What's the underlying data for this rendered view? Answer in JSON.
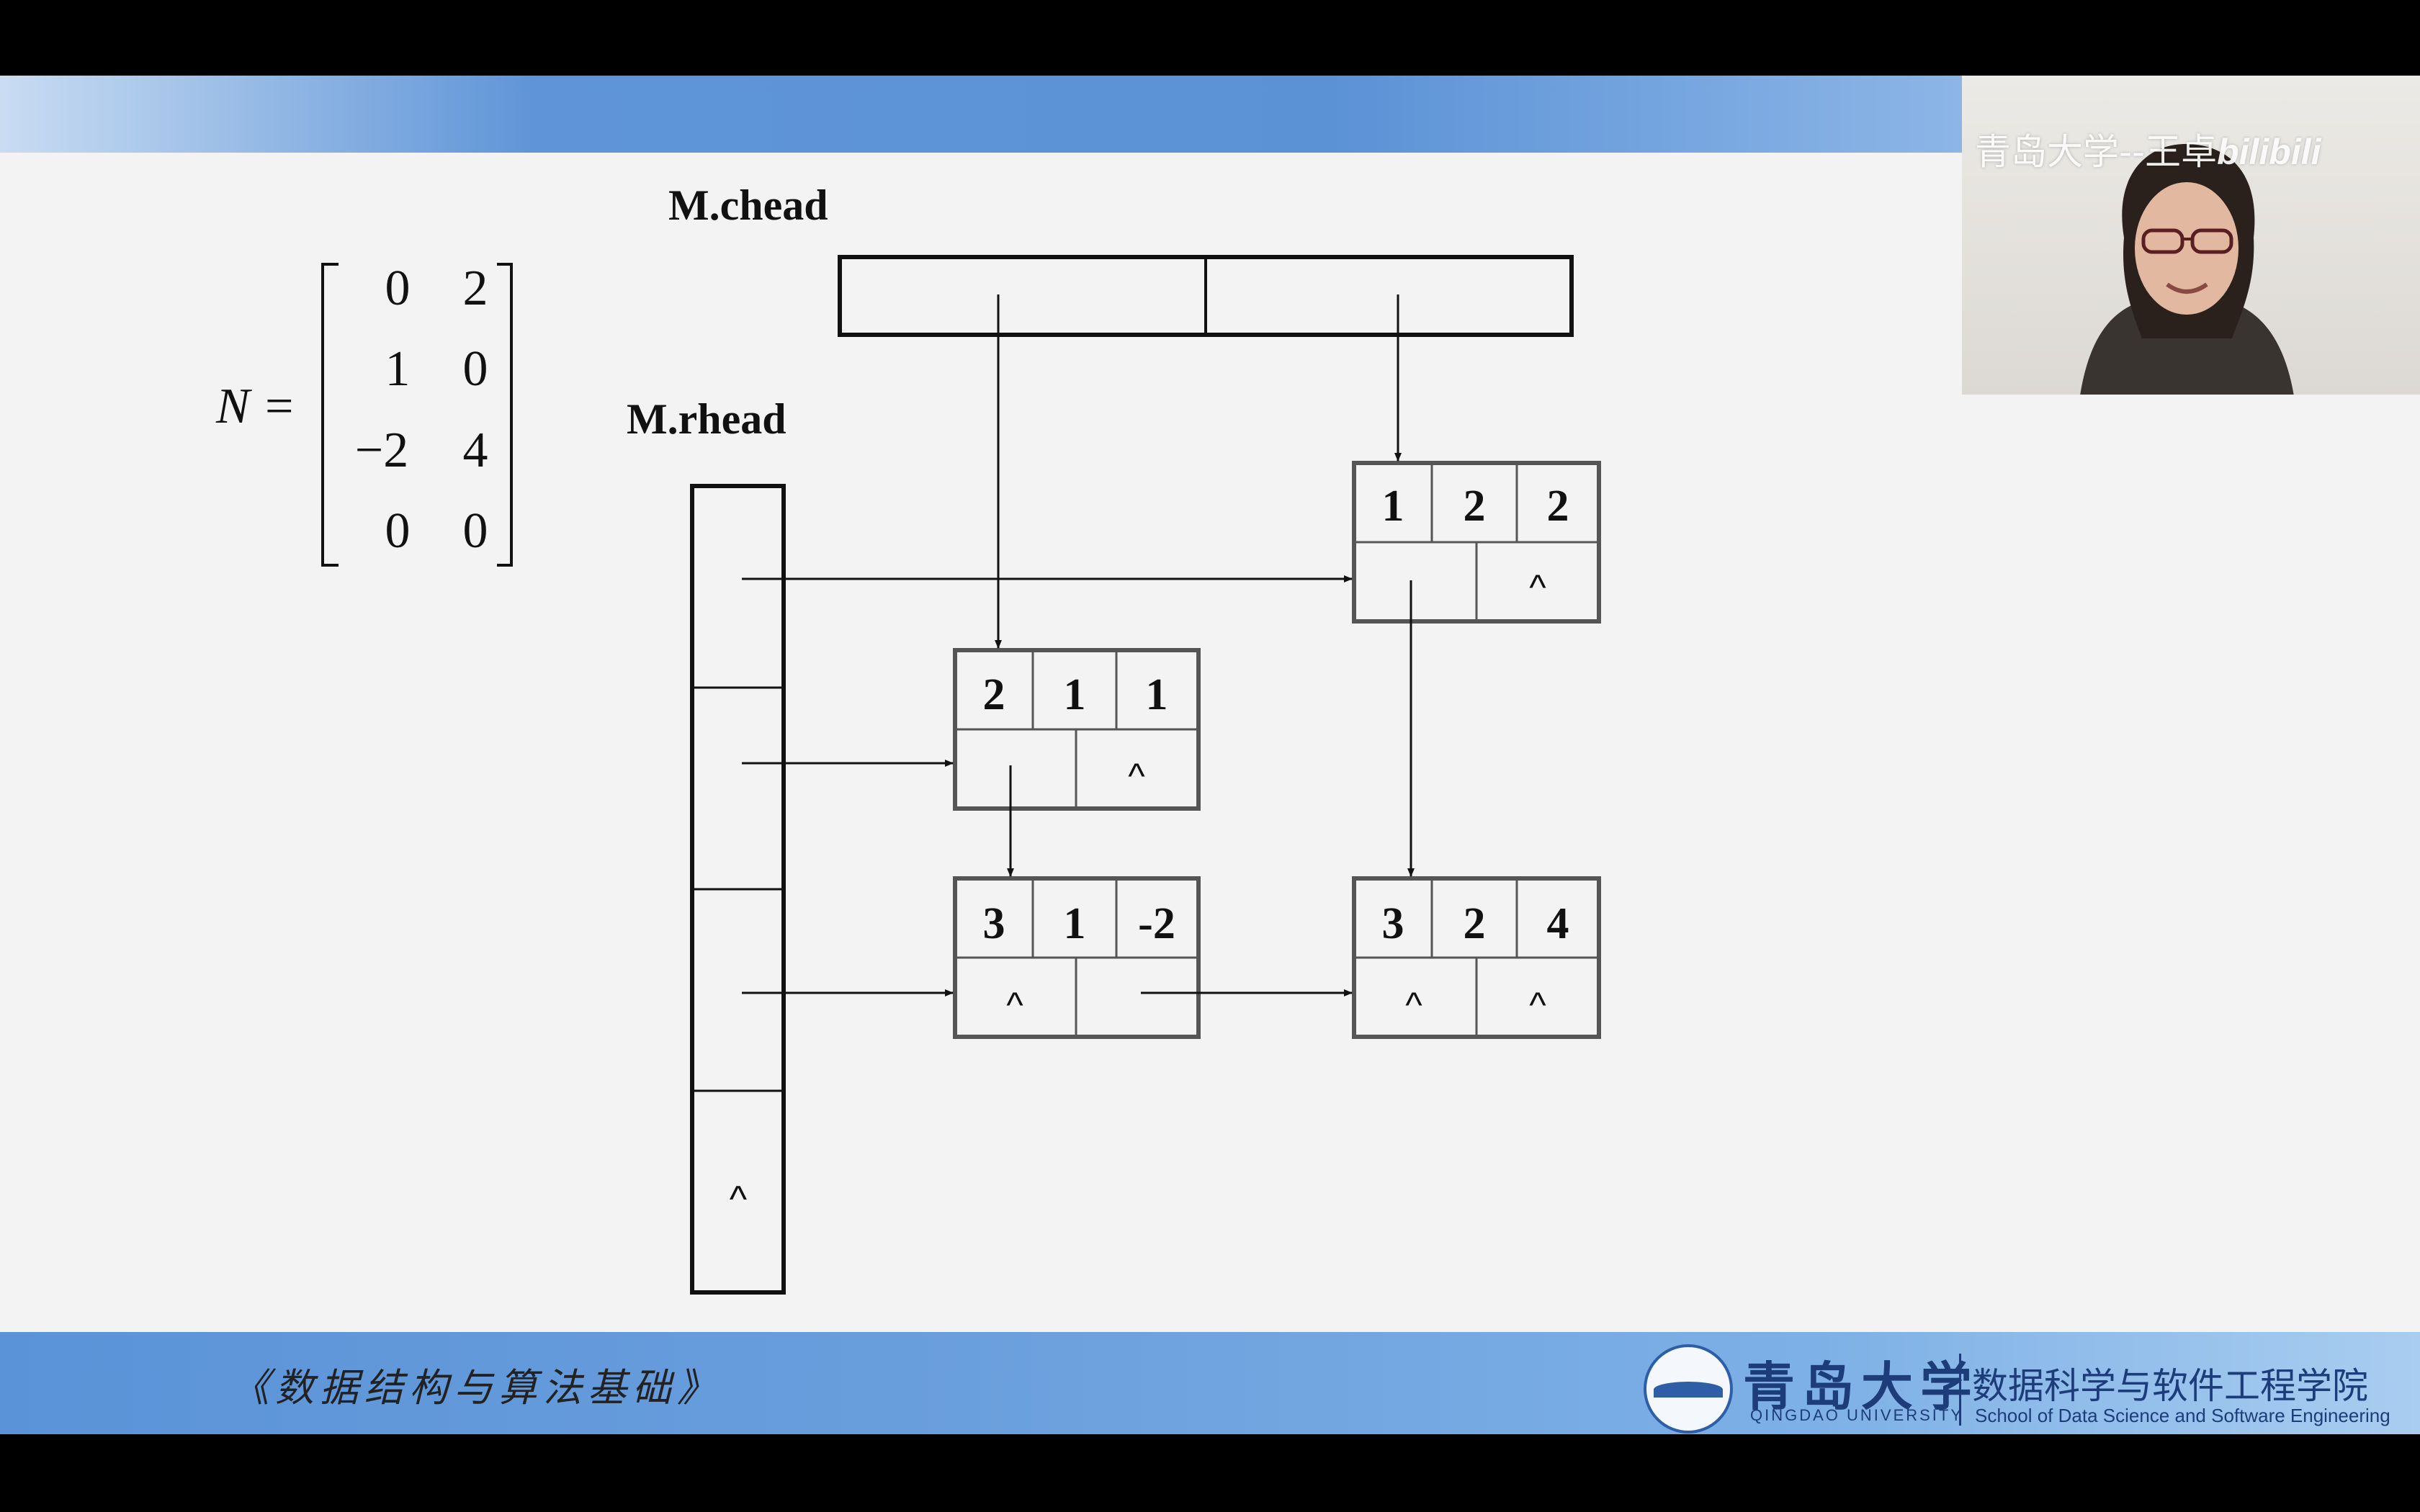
{
  "matrix": {
    "name": "N",
    "equals": "=",
    "rows": [
      [
        "0",
        "2"
      ],
      [
        "1",
        "0"
      ],
      [
        "−2",
        "4"
      ],
      [
        "0",
        "0"
      ]
    ]
  },
  "labels": {
    "chead": "M.chead",
    "rhead": "M.rhead",
    "null_symbol": "^"
  },
  "nodes": [
    {
      "id": "n122",
      "cells": [
        "1",
        "2",
        "2"
      ],
      "right": "",
      "down": "^"
    },
    {
      "id": "n211",
      "cells": [
        "2",
        "1",
        "1"
      ],
      "right": "",
      "down": "^"
    },
    {
      "id": "n31m2",
      "cells": [
        "3",
        "1",
        "-2"
      ],
      "right": "^",
      "down": ""
    },
    {
      "id": "n324",
      "cells": [
        "3",
        "2",
        "4"
      ],
      "right": "^",
      "down": "^"
    }
  ],
  "rhead_last_cell": "^",
  "footer": {
    "course_title": "《数据结构与算法基础》",
    "university_cn": "青岛大学",
    "university_en": "QINGDAO UNIVERSITY",
    "school_cn": "数据科学与软件工程学院",
    "school_en": "School of Data Science and Software Engineering"
  },
  "webcam": {
    "watermark": "青岛大学--王卓",
    "watermark_brand": "bilibili"
  }
}
